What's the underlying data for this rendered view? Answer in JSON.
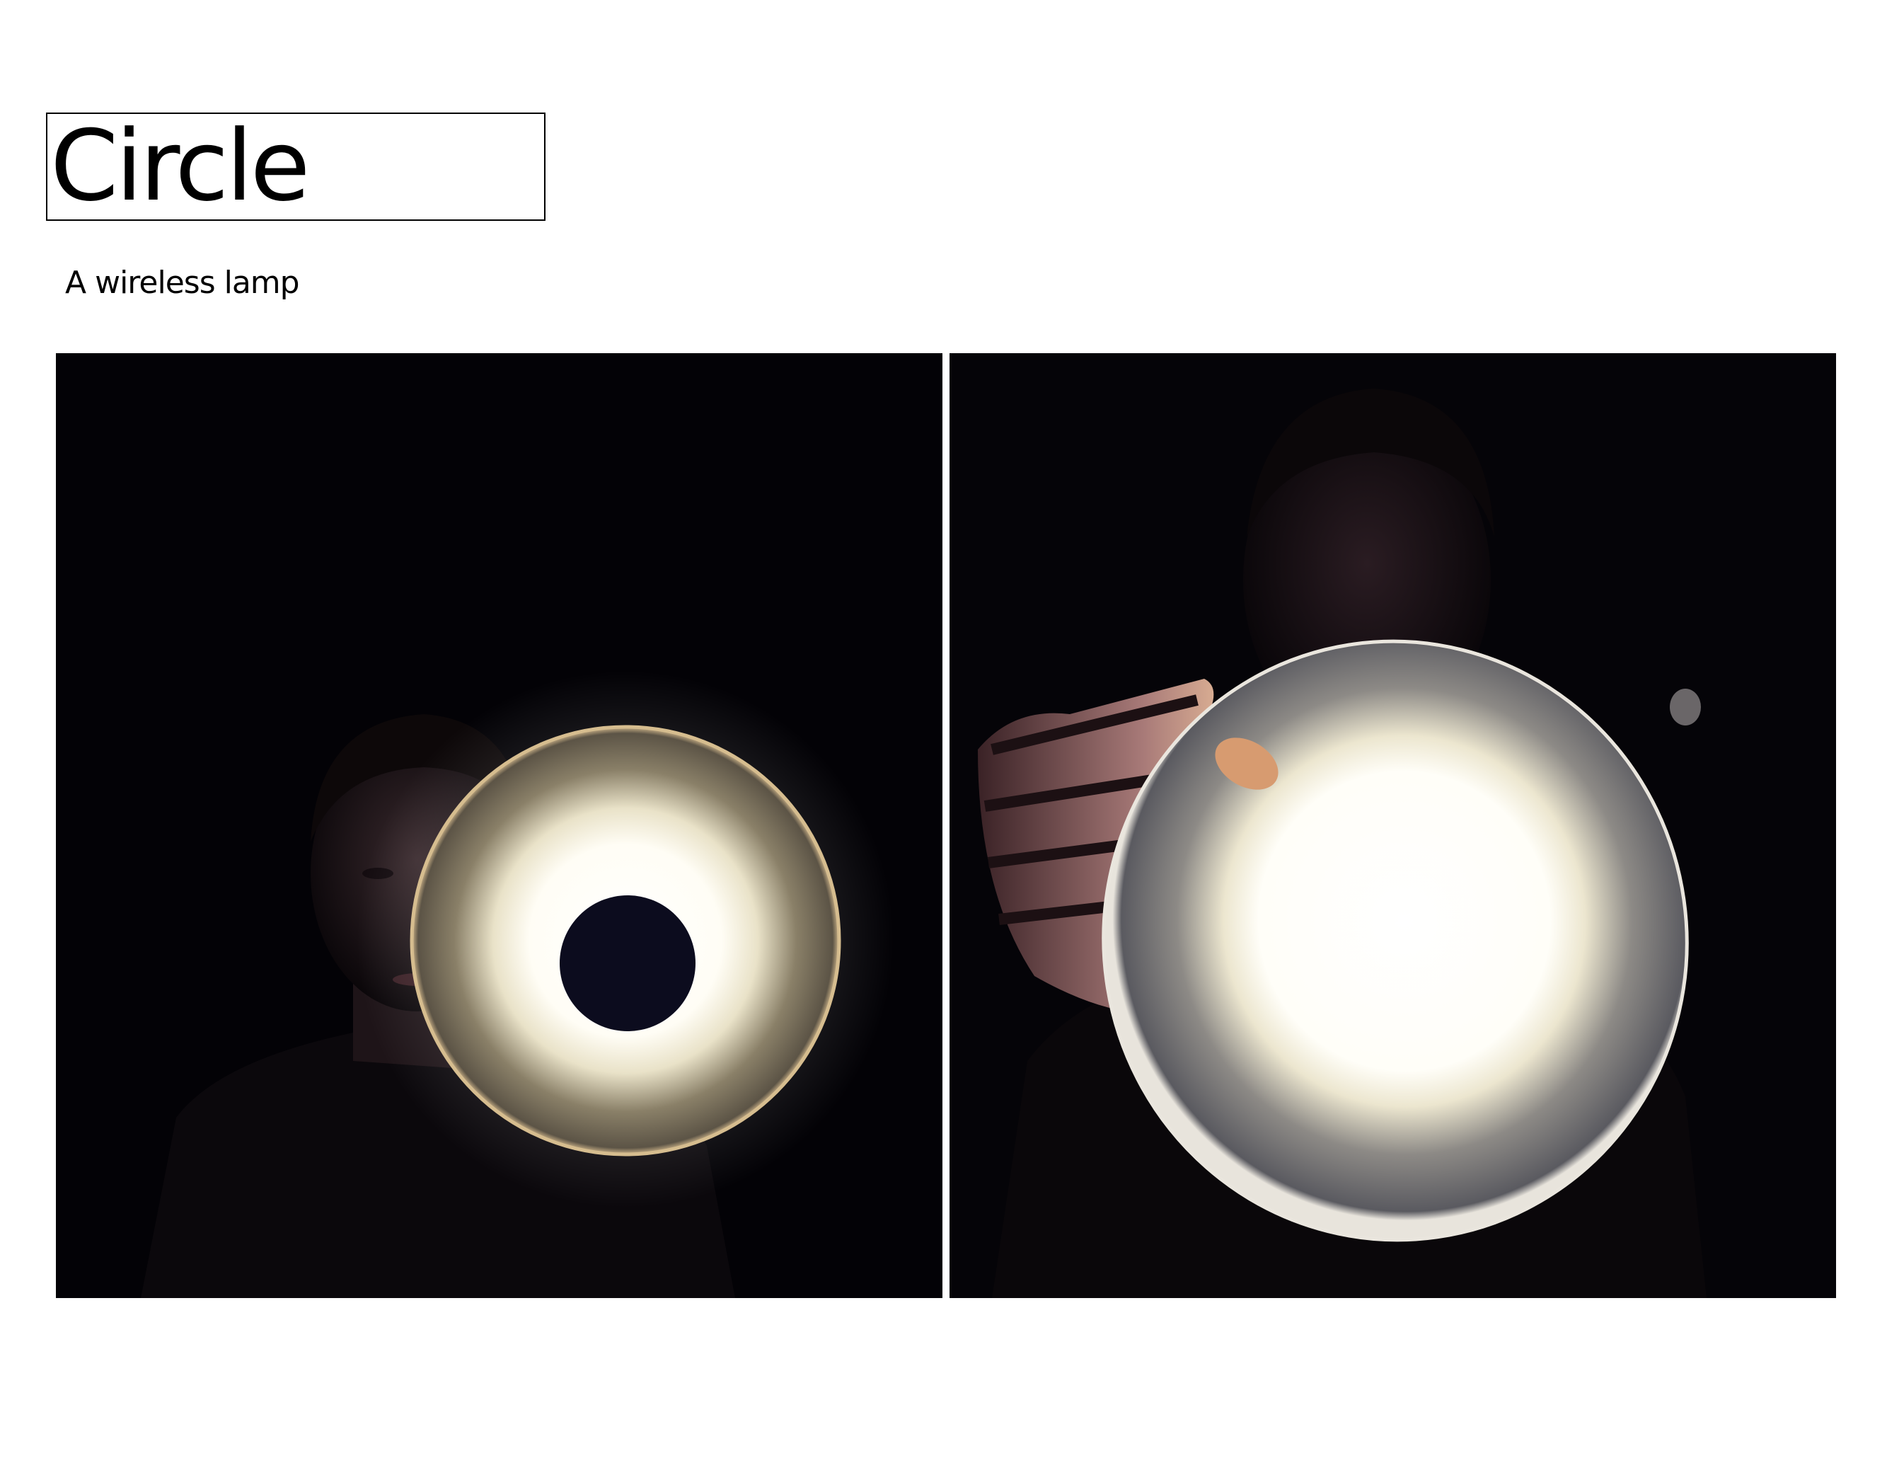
{
  "title": "Circle",
  "subtitle": "A wireless lamp",
  "photos": [
    {
      "subject": "person-holding-ring-lamp"
    },
    {
      "subject": "hand-holding-disc-lamp"
    }
  ],
  "colors": {
    "background": "#ffffff",
    "text": "#000000",
    "photo_background": "#030206",
    "lamp_glow": "#fffdf5",
    "lamp_rim": "#cfb58a"
  }
}
